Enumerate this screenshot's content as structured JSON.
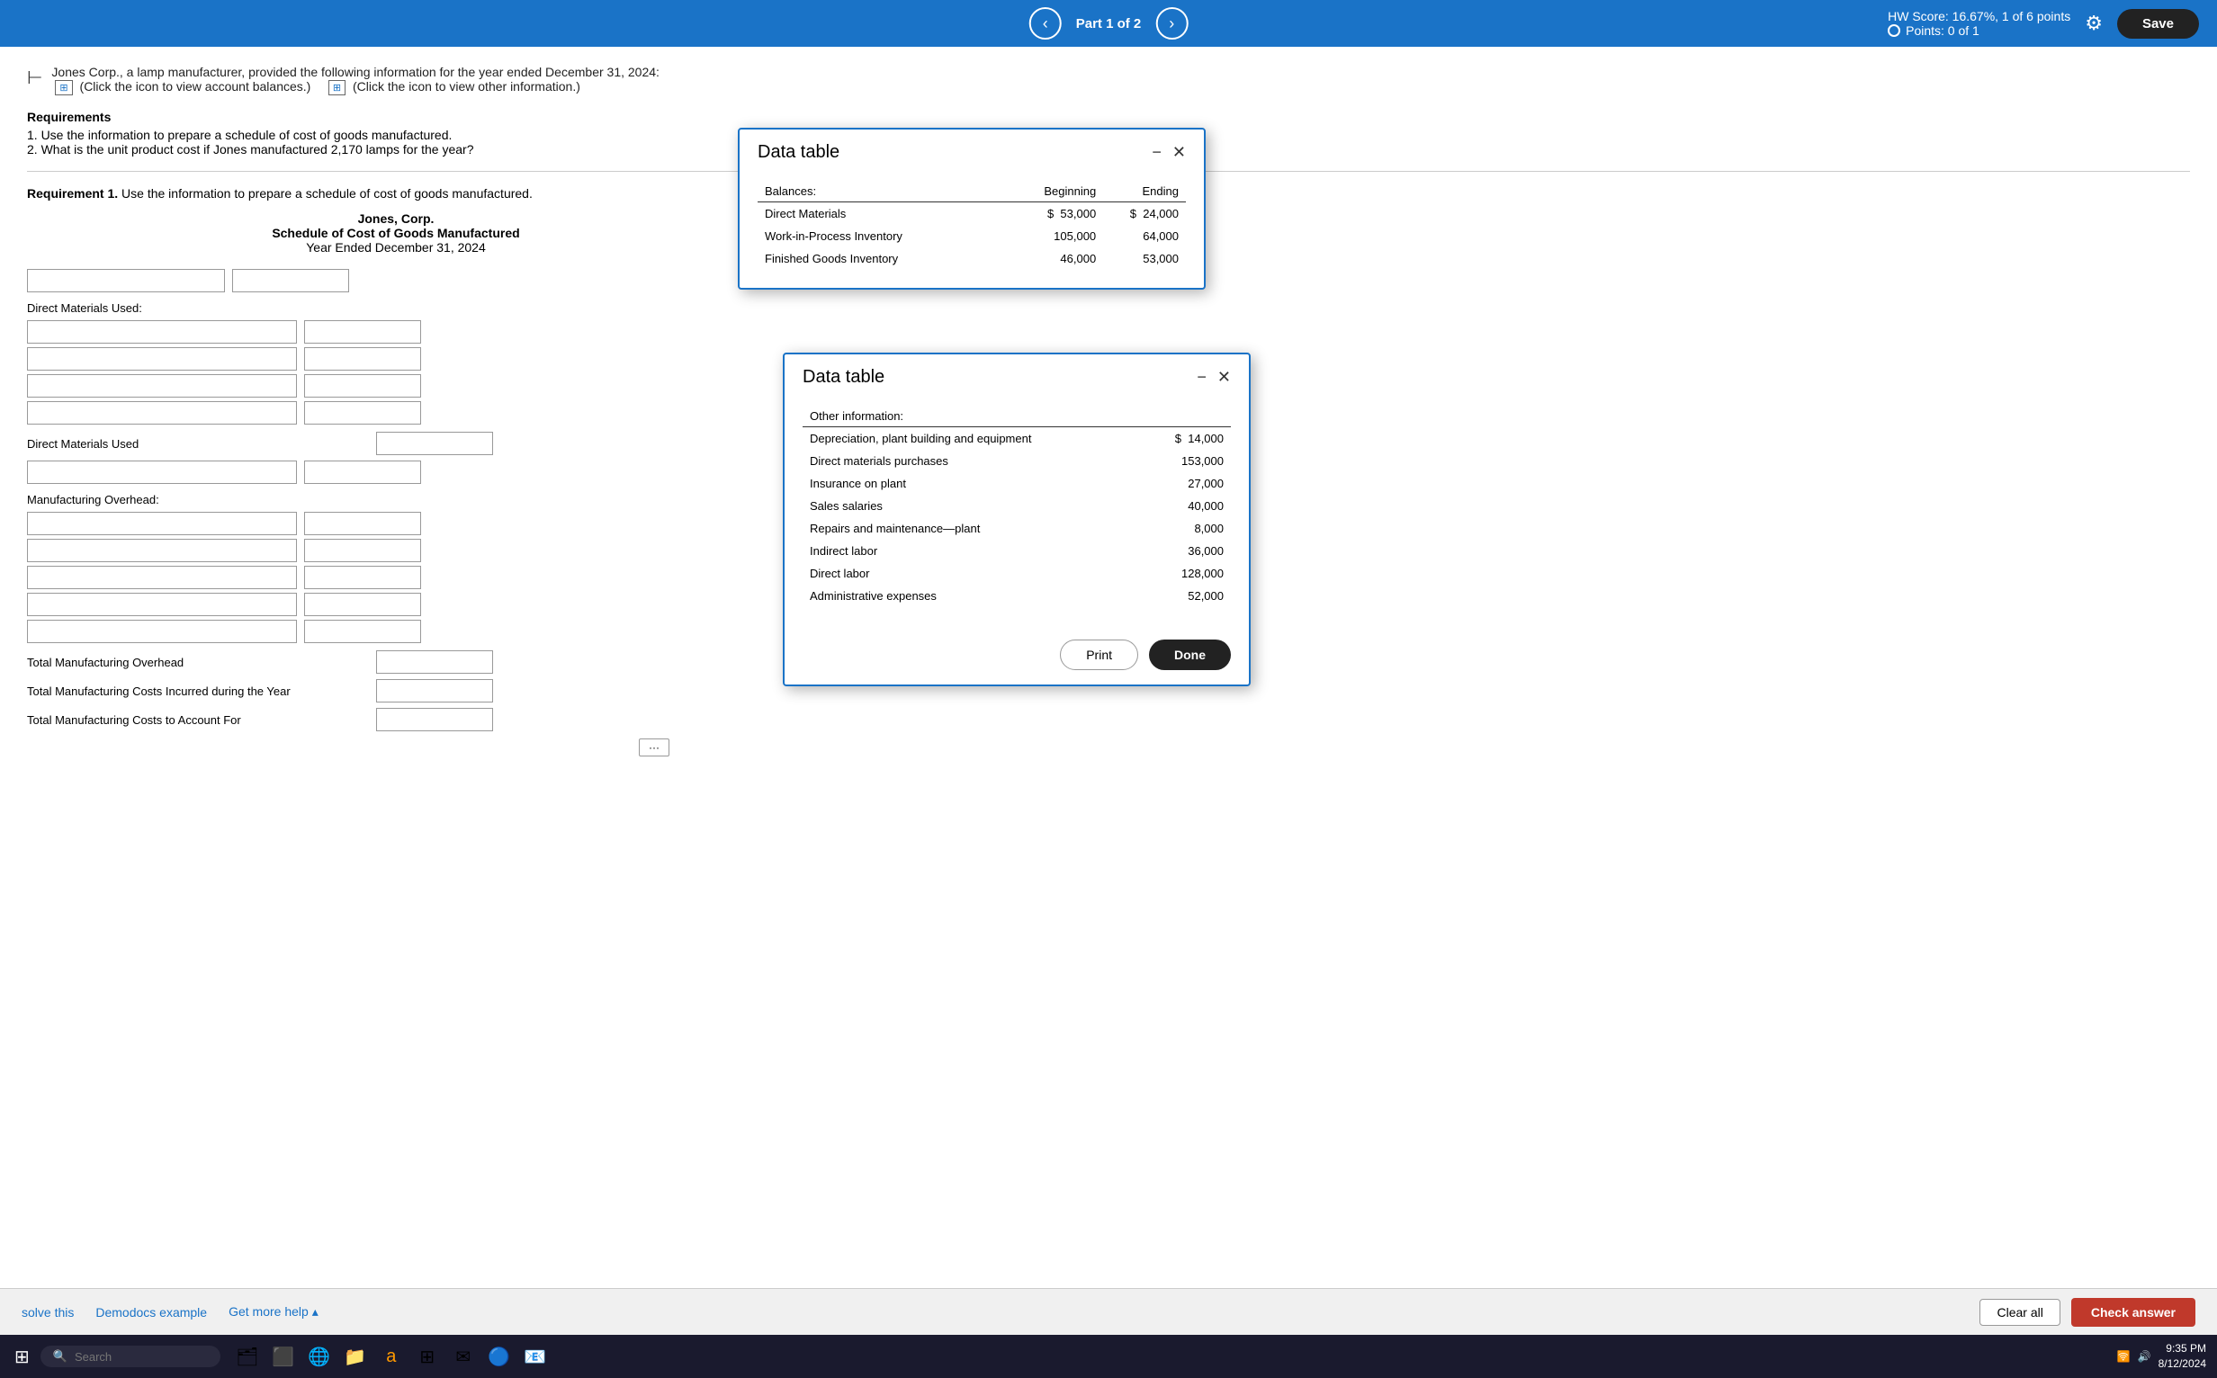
{
  "topbar": {
    "prev_label": "‹",
    "next_label": "›",
    "part_label": "Part 1 of 2",
    "hw_score": "HW Score: 16.67%, 1 of 6 points",
    "points": "Points: 0 of 1",
    "save_label": "Save",
    "gear_label": "⚙"
  },
  "header": {
    "back_icon": "⊢",
    "intro_text": "Jones Corp., a lamp manufacturer, provided the following information for the year ended December 31, 2024:",
    "icon1_label": "⊞",
    "click1_label": "(Click the icon to view account balances.)",
    "icon2_label": "⊞",
    "click2_label": "(Click the icon to view other information.)"
  },
  "requirements": {
    "title": "Requirements",
    "item1": "1. Use the information to prepare a schedule of cost of goods manufactured.",
    "item2": "2. What is the unit product cost if Jones manufactured 2,170 lamps for the year?"
  },
  "req1_label": "Requirement 1.",
  "req1_text": "Use the information to prepare a schedule of cost of goods manufactured.",
  "schedule": {
    "company": "Jones, Corp.",
    "title": "Schedule of Cost of Goods Manufactured",
    "period": "Year Ended December 31, 2024",
    "direct_materials_label": "Direct Materials Used:",
    "dm_rows": [
      {
        "label": "",
        "col1": "",
        "col2": ""
      },
      {
        "label": "",
        "col1": "",
        "col2": ""
      },
      {
        "label": "",
        "col1": "",
        "col2": ""
      },
      {
        "label": "",
        "col1": "",
        "col2": ""
      }
    ],
    "direct_materials_used_label": "Direct Materials Used",
    "manufacturing_overhead_label": "Manufacturing Overhead:",
    "mo_rows": [
      {
        "label": "",
        "col1": "",
        "col2": ""
      },
      {
        "label": "",
        "col1": "",
        "col2": ""
      },
      {
        "label": "",
        "col1": "",
        "col2": ""
      },
      {
        "label": "",
        "col1": "",
        "col2": ""
      },
      {
        "label": "",
        "col1": "",
        "col2": ""
      }
    ],
    "total_mfg_overhead": "Total Manufacturing Overhead",
    "total_mfg_costs": "Total Manufacturing Costs Incurred during the Year",
    "total_mfg_to_account": "Total Manufacturing Costs to Account For"
  },
  "data_table1": {
    "title": "Data table",
    "balances_label": "Balances:",
    "beginning_label": "Beginning",
    "ending_label": "Ending",
    "rows": [
      {
        "label": "Direct Materials",
        "symbol": "$",
        "beginning": "53,000",
        "beginning_sym": "$",
        "ending": "24,000"
      },
      {
        "label": "Work-in-Process Inventory",
        "symbol": "",
        "beginning": "105,000",
        "ending": "64,000"
      },
      {
        "label": "Finished Goods Inventory",
        "symbol": "",
        "beginning": "46,000",
        "ending": "53,000"
      }
    ]
  },
  "data_table2": {
    "title": "Data table",
    "other_info_label": "Other information:",
    "rows": [
      {
        "label": "Depreciation, plant building and equipment",
        "symbol": "$",
        "value": "14,000"
      },
      {
        "label": "Direct materials purchases",
        "symbol": "",
        "value": "153,000"
      },
      {
        "label": "Insurance on plant",
        "symbol": "",
        "value": "27,000"
      },
      {
        "label": "Sales salaries",
        "symbol": "",
        "value": "40,000"
      },
      {
        "label": "Repairs and maintenance—plant",
        "symbol": "",
        "value": "8,000"
      },
      {
        "label": "Indirect labor",
        "symbol": "",
        "value": "36,000"
      },
      {
        "label": "Direct labor",
        "symbol": "",
        "value": "128,000"
      },
      {
        "label": "Administrative expenses",
        "symbol": "",
        "value": "52,000"
      }
    ],
    "print_label": "Print",
    "done_label": "Done"
  },
  "taskbar": {
    "solve_label": "solve this",
    "demodocs_label": "Demodocs example",
    "help_label": "Get more help ▴",
    "clear_all_label": "Clear all",
    "check_answer_label": "Check answer"
  },
  "windows_taskbar": {
    "search_placeholder": "Search",
    "time": "9:35 PM",
    "date": "8/12/2024"
  }
}
